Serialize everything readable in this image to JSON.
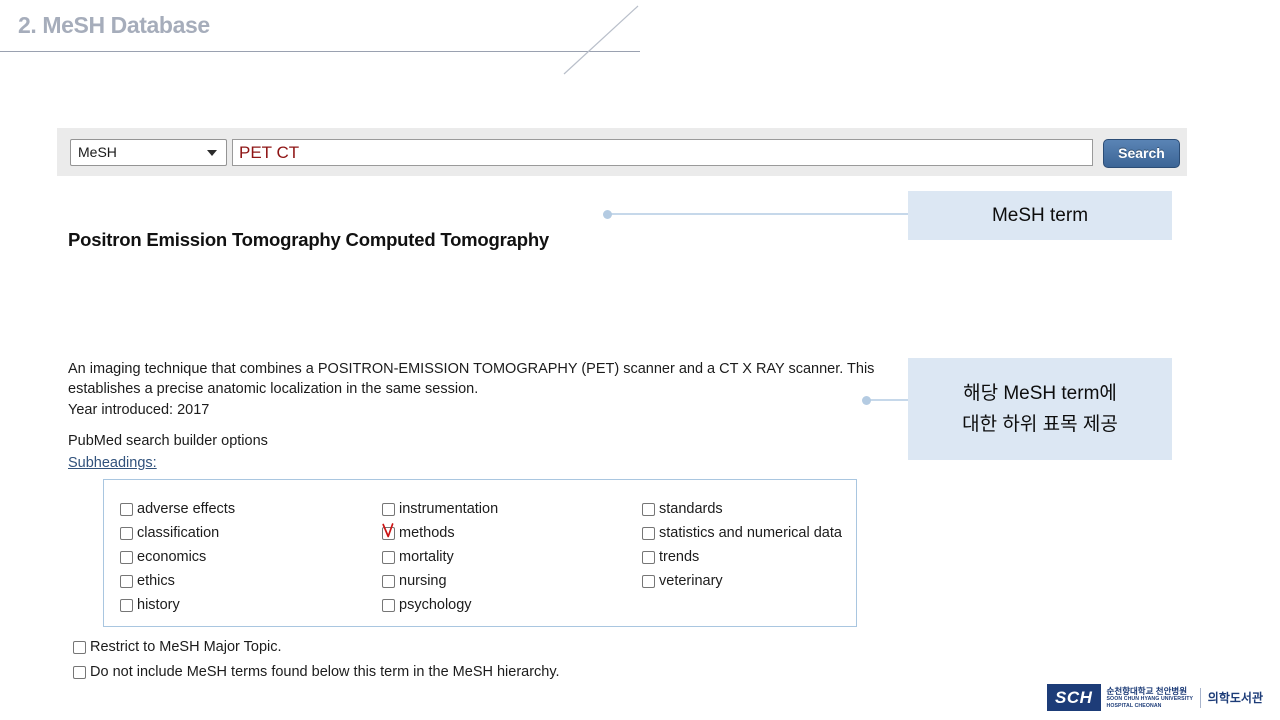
{
  "slide": {
    "title": "2. MeSH Database"
  },
  "search": {
    "database_selected": "MeSH",
    "database_options": [
      "MeSH"
    ],
    "query_value": "PET CT",
    "query_placeholder": "",
    "search_button_label": "Search"
  },
  "result": {
    "title": "Positron Emission Tomography Computed Tomography",
    "description": "An imaging technique that combines a POSITRON-EMISSION TOMOGRAPHY (PET) scanner and a CT X RAY scanner. This establishes a precise anatomic localization in the same session.",
    "year_introduced": "Year introduced: 2017",
    "builder_options_label": "PubMed search builder options",
    "subheadings_link": "Subheadings:"
  },
  "subheadings": {
    "columns": [
      [
        {
          "label": "adverse effects",
          "checked": false,
          "annotated": false
        },
        {
          "label": "classification",
          "checked": false,
          "annotated": false
        },
        {
          "label": "economics",
          "checked": false,
          "annotated": false
        },
        {
          "label": "ethics",
          "checked": false,
          "annotated": false
        },
        {
          "label": "history",
          "checked": false,
          "annotated": false
        }
      ],
      [
        {
          "label": "instrumentation",
          "checked": false,
          "annotated": false
        },
        {
          "label": "methods",
          "checked": false,
          "annotated": true
        },
        {
          "label": "mortality",
          "checked": false,
          "annotated": false
        },
        {
          "label": "nursing",
          "checked": false,
          "annotated": false
        },
        {
          "label": "psychology",
          "checked": false,
          "annotated": false
        }
      ],
      [
        {
          "label": "standards",
          "checked": false,
          "annotated": false
        },
        {
          "label": "statistics and numerical data",
          "checked": false,
          "annotated": false
        },
        {
          "label": "trends",
          "checked": false,
          "annotated": false
        },
        {
          "label": "veterinary",
          "checked": false,
          "annotated": false
        }
      ]
    ]
  },
  "restrict": {
    "major_topic": "Restrict to MeSH Major Topic.",
    "no_hierarchy": "Do not include MeSH terms found below this term in the MeSH hierarchy."
  },
  "callouts": {
    "mesh_term": "MeSH term",
    "subheading_line1": "해당 MeSH term에",
    "subheading_line2": "대한 하위 표목 제공"
  },
  "footer": {
    "mark": "SCH",
    "university_ko": "순천향대학교 천안병원",
    "university_en_line1": "SOON CHUN HYANG UNIVERSITY",
    "university_en_line2": "HOSPITAL CHEONAN",
    "library": "의학도서관"
  },
  "colors": {
    "accent_blue": "#3c6596",
    "callout_bg": "#dce7f3",
    "annotation_red": "#cc1414",
    "query_text": "#8e1414",
    "brand_navy": "#1d3c78",
    "title_gray": "#a6adbb"
  }
}
